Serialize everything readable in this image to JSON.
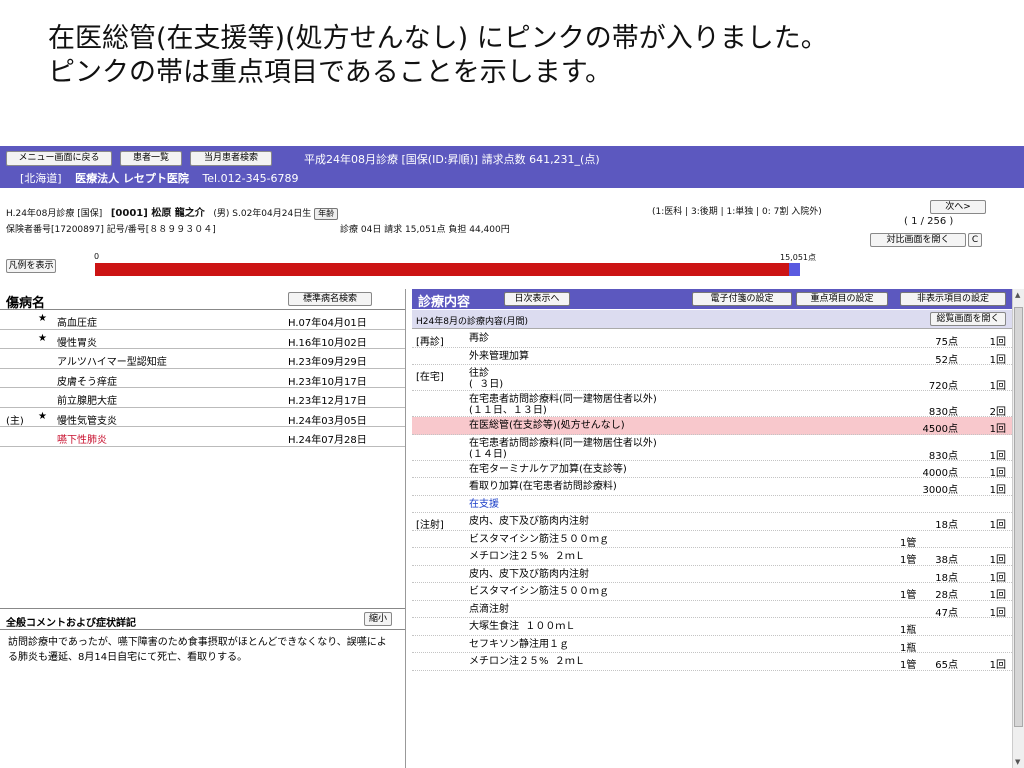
{
  "caption": {
    "line1": "在医総管(在支援等)(処方せんなし) にピンクの帯が入りました。",
    "line2": "ピンクの帯は重点項目であることを示します。"
  },
  "header": {
    "buttons": [
      "メニュー画面に戻る",
      "患者一覧",
      "当月患者検索"
    ],
    "info": "平成24年08月診療 [国保(ID:昇順)] 請求点数 641,231_(点)",
    "region": "[北海道]",
    "hospital": "医療法人 レセプト医院",
    "tel": "Tel.012-345-6789"
  },
  "patient": {
    "line1_prefix": "H.24年08月診療 [国保]",
    "id_name": "[0001] 松原 龍之介",
    "sex_birth": "(男) S.02年04月24日生",
    "age_button": "年齢",
    "legend_text": "(1:医科 | 3:後期 | 1:単独 | 0: 7割 入院外)",
    "next_button": "次へ>",
    "page_counter": "( 1 / 256 )",
    "line2": "保険者番号[17200897]   記号/番号[８８９９３０４]",
    "billing": "診療 04日 請求 15,051点 負担 44,400円",
    "compare_button": "対比画面を開く",
    "c_button": "C"
  },
  "legend_button": "凡例を表示",
  "progress": {
    "zero_label": "0",
    "total_label": "15,051点",
    "fill_fraction": 0.985
  },
  "diseases": {
    "title": "傷病名",
    "search_button": "標準病名検索",
    "rows": [
      {
        "pre": "",
        "star": "★",
        "name": "高血圧症",
        "date": "H.07年04月01日",
        "red": false
      },
      {
        "pre": "",
        "star": "★",
        "name": "慢性胃炎",
        "date": "H.16年10月02日",
        "red": false
      },
      {
        "pre": "",
        "star": "",
        "name": "アルツハイマー型認知症",
        "date": "H.23年09月29日",
        "red": false
      },
      {
        "pre": "",
        "star": "",
        "name": "皮膚そう痒症",
        "date": "H.23年10月17日",
        "red": false
      },
      {
        "pre": "",
        "star": "",
        "name": "前立腺肥大症",
        "date": "H.23年12月17日",
        "red": false
      },
      {
        "pre": "(主)",
        "star": "★",
        "name": "慢性気管支炎",
        "date": "H.24年03月05日",
        "red": false
      },
      {
        "pre": "",
        "star": "",
        "name": "嚥下性肺炎",
        "date": "H.24年07月28日",
        "red": true
      }
    ]
  },
  "comment": {
    "title": "全般コメントおよび症状詳記",
    "shrink_button": "縮小",
    "text": "訪問診療中であったが、嚥下障害のため食事摂取がほとんどできなくなり、誤嚥による肺炎も遷延、8月14日自宅にて死亡、看取りする。"
  },
  "treatment": {
    "title": "診療内容",
    "daily_button": "日次表示へ",
    "buttons": [
      "電子付箋の設定",
      "重点項目の設定",
      "非表示項目の設定"
    ],
    "subtitle": "H24年8月の診療内容(月間)",
    "overview_button": "総覧画面を開く",
    "rows": [
      {
        "cat": "[再診]",
        "item": "再診",
        "qty": "",
        "pts": "75点",
        "cnt": "1回",
        "tall": false,
        "hl": false,
        "link": false
      },
      {
        "cat": "",
        "item": "外来管理加算",
        "qty": "",
        "pts": "52点",
        "cnt": "1回",
        "tall": false,
        "hl": false,
        "link": false
      },
      {
        "cat": "[在宅]",
        "item": "往診\n(  ３日)",
        "qty": "",
        "pts": "720点",
        "cnt": "1回",
        "tall": true,
        "hl": false,
        "link": false
      },
      {
        "cat": "",
        "item": "在宅患者訪問診療料(同一建物居住者以外)\n(１１日、１３日)",
        "qty": "",
        "pts": "830点",
        "cnt": "2回",
        "tall": true,
        "hl": false,
        "link": false
      },
      {
        "cat": "",
        "item": "在医総管(在支診等)(処方せんなし)",
        "qty": "",
        "pts": "4500点",
        "cnt": "1回",
        "tall": false,
        "hl": true,
        "link": false
      },
      {
        "cat": "",
        "item": "在宅患者訪問診療料(同一建物居住者以外)\n(１４日)",
        "qty": "",
        "pts": "830点",
        "cnt": "1回",
        "tall": true,
        "hl": false,
        "link": false
      },
      {
        "cat": "",
        "item": "在宅ターミナルケア加算(在支診等)",
        "qty": "",
        "pts": "4000点",
        "cnt": "1回",
        "tall": false,
        "hl": false,
        "link": false
      },
      {
        "cat": "",
        "item": "看取り加算(在宅患者訪問診療料)",
        "qty": "",
        "pts": "3000点",
        "cnt": "1回",
        "tall": false,
        "hl": false,
        "link": false
      },
      {
        "cat": "",
        "item": "在支援",
        "qty": "",
        "pts": "",
        "cnt": "",
        "tall": false,
        "hl": false,
        "link": true
      },
      {
        "cat": "[注射]",
        "item": "皮内、皮下及び筋肉内注射",
        "qty": "",
        "pts": "18点",
        "cnt": "1回",
        "tall": false,
        "hl": false,
        "link": false
      },
      {
        "cat": "",
        "item": "ビスタマイシン筋注５００ｍｇ",
        "qty": "1管",
        "pts": "",
        "cnt": "",
        "tall": false,
        "hl": false,
        "link": false
      },
      {
        "cat": "",
        "item": "メチロン注２５%  ２ｍＬ",
        "qty": "1管",
        "pts": "38点",
        "cnt": "1回",
        "tall": false,
        "hl": false,
        "link": false
      },
      {
        "cat": "",
        "item": "皮内、皮下及び筋肉内注射",
        "qty": "",
        "pts": "18点",
        "cnt": "1回",
        "tall": false,
        "hl": false,
        "link": false
      },
      {
        "cat": "",
        "item": "ビスタマイシン筋注５００ｍｇ",
        "qty": "1管",
        "pts": "28点",
        "cnt": "1回",
        "tall": false,
        "hl": false,
        "link": false
      },
      {
        "cat": "",
        "item": "点滴注射",
        "qty": "",
        "pts": "47点",
        "cnt": "1回",
        "tall": false,
        "hl": false,
        "link": false
      },
      {
        "cat": "",
        "item": "大塚生食注  １００ｍＬ",
        "qty": "1瓶",
        "pts": "",
        "cnt": "",
        "tall": false,
        "hl": false,
        "link": false
      },
      {
        "cat": "",
        "item": "セフキソン静注用１ｇ",
        "qty": "1瓶",
        "pts": "",
        "cnt": "",
        "tall": false,
        "hl": false,
        "link": false
      },
      {
        "cat": "",
        "item": "メチロン注２５%  ２ｍＬ",
        "qty": "1管",
        "pts": "65点",
        "cnt": "1回",
        "tall": false,
        "hl": false,
        "link": false
      }
    ]
  }
}
